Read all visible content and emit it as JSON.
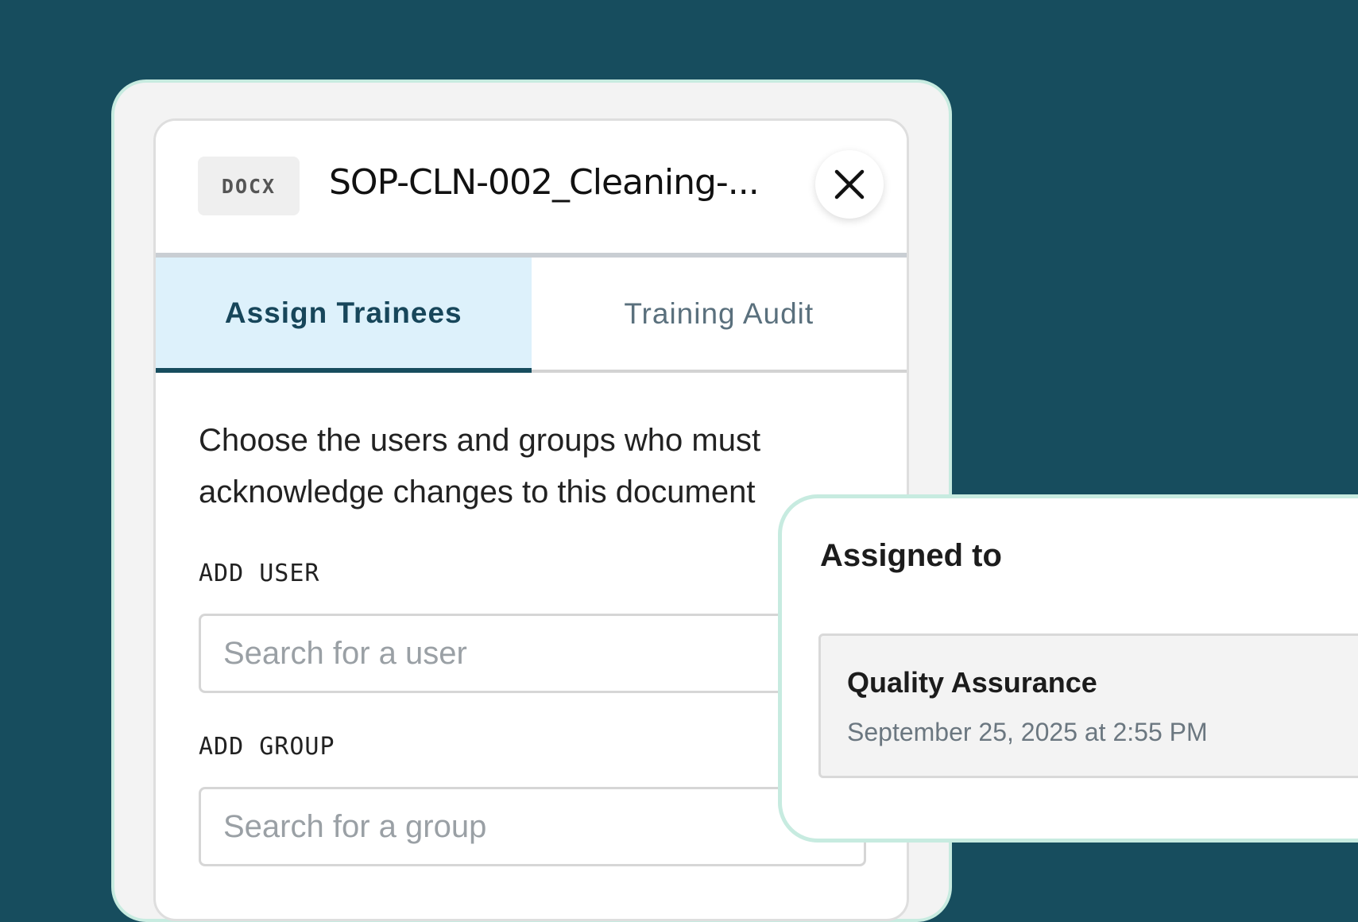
{
  "document": {
    "file_type": "DOCX",
    "title": "SOP-CLN-002_Cleaning-..."
  },
  "tabs": [
    {
      "label": "Assign Trainees",
      "active": true
    },
    {
      "label": "Training Audit",
      "active": false
    }
  ],
  "assign": {
    "instruction": "Choose the users and groups who must acknowledge changes to this document",
    "add_user_label": "ADD USER",
    "user_placeholder": "Search for a user",
    "add_group_label": "ADD GROUP",
    "group_placeholder": "Search for a group"
  },
  "assigned_to": {
    "title": "Assigned to",
    "items": [
      {
        "name": "Quality Assurance",
        "date": "September 25, 2025 at 2:55 PM"
      }
    ]
  },
  "icons": {
    "close": "close-icon"
  },
  "colors": {
    "background": "#174d5e",
    "accent": "#174d5e",
    "active_tab_bg": "#ddf1fb",
    "frame_border": "#c7ebe0"
  }
}
